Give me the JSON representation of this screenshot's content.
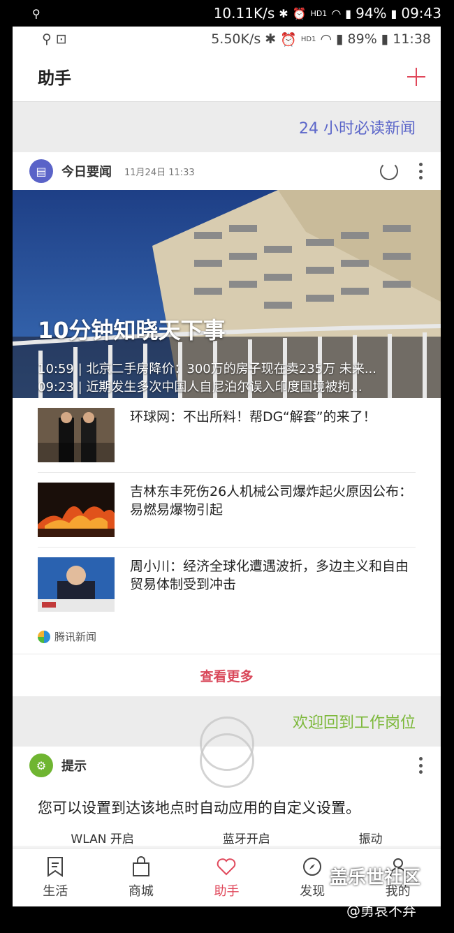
{
  "outer_status": {
    "speed": "10.11K/s",
    "network": "HD1",
    "battery": "94%",
    "time": "09:43"
  },
  "inner_status": {
    "speed": "5.50K/s",
    "network": "HD1",
    "battery": "89%",
    "time": "11:38"
  },
  "header": {
    "title": "助手"
  },
  "band1": {
    "label": "24 小时必读新闻"
  },
  "news_card": {
    "title": "今日要闻",
    "date": "11月24日 11:33",
    "hero_title": "10分钟知晓天下事",
    "hero_lines": [
      "10:59 | 北京二手房降价：300万的房子现在卖235万 未来...",
      "09:23 | 近期发生多次中国人自尼泊尔误入印度国境被拘..."
    ],
    "items": [
      {
        "text": "环球网：不出所料！帮DG“解套”的来了！"
      },
      {
        "text": "吉林东丰死伤26人机械公司爆炸起火原因公布：易燃易爆物引起"
      },
      {
        "text": "周小川：经济全球化遭遇波折，多边主义和自由贸易体制受到冲击"
      }
    ],
    "source": "腾讯新闻",
    "see_more": "查看更多"
  },
  "band2": {
    "label": "欢迎回到工作岗位"
  },
  "tip_card": {
    "title": "提示",
    "text": "您可以设置到达该地点时自动应用的自定义设置。",
    "actions": [
      "WLAN 开启",
      "蓝牙开启",
      "振动"
    ]
  },
  "nav": {
    "items": [
      {
        "label": "生活",
        "icon": "bookmark-icon"
      },
      {
        "label": "商城",
        "icon": "bag-icon"
      },
      {
        "label": "助手",
        "icon": "heart-icon"
      },
      {
        "label": "发现",
        "icon": "compass-icon"
      },
      {
        "label": "我的",
        "icon": "person-icon"
      }
    ],
    "active_color": "#e0475a"
  },
  "watermark": {
    "line1": "盖乐世社区",
    "line2": "@勇哀不弃"
  }
}
